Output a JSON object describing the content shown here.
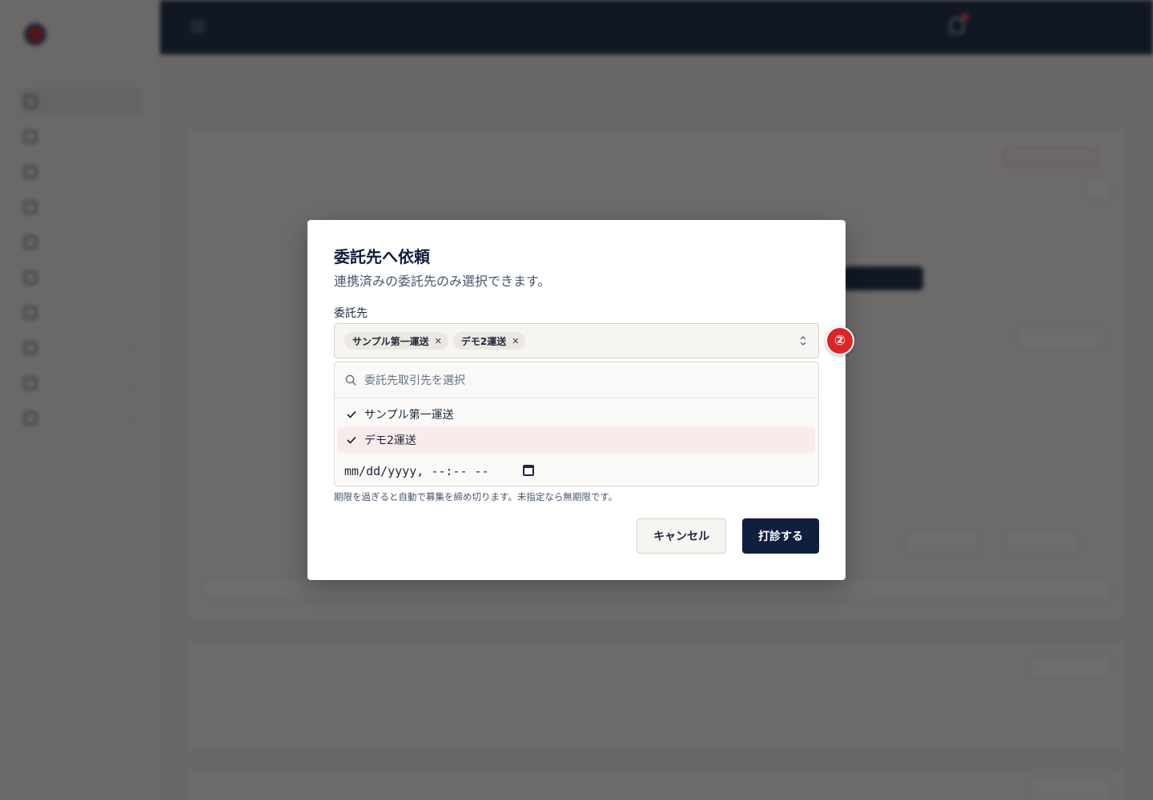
{
  "modal": {
    "title": "委託先へ依頼",
    "description": "連携済みの委託先のみ選択できます。",
    "field_label": "委託先",
    "selected_chips": [
      "サンプル第一運送",
      "デモ2運送"
    ],
    "search_placeholder": "委託先取引先を選択",
    "options": [
      {
        "label": "サンプル第一運送",
        "checked": true
      },
      {
        "label": "デモ2運送",
        "checked": true
      }
    ],
    "date_placeholder": "mm/dd/yyyy, --:-- --",
    "help_text": "期限を過ぎると自動で募集を締め切ります。未指定なら無期限です。",
    "cancel_label": "キャンセル",
    "submit_label": "打診する"
  },
  "step_badge": "②",
  "colors": {
    "navy": "#0f1f3d",
    "badge_red": "#dc2626",
    "highlight": "#f8eceb"
  }
}
